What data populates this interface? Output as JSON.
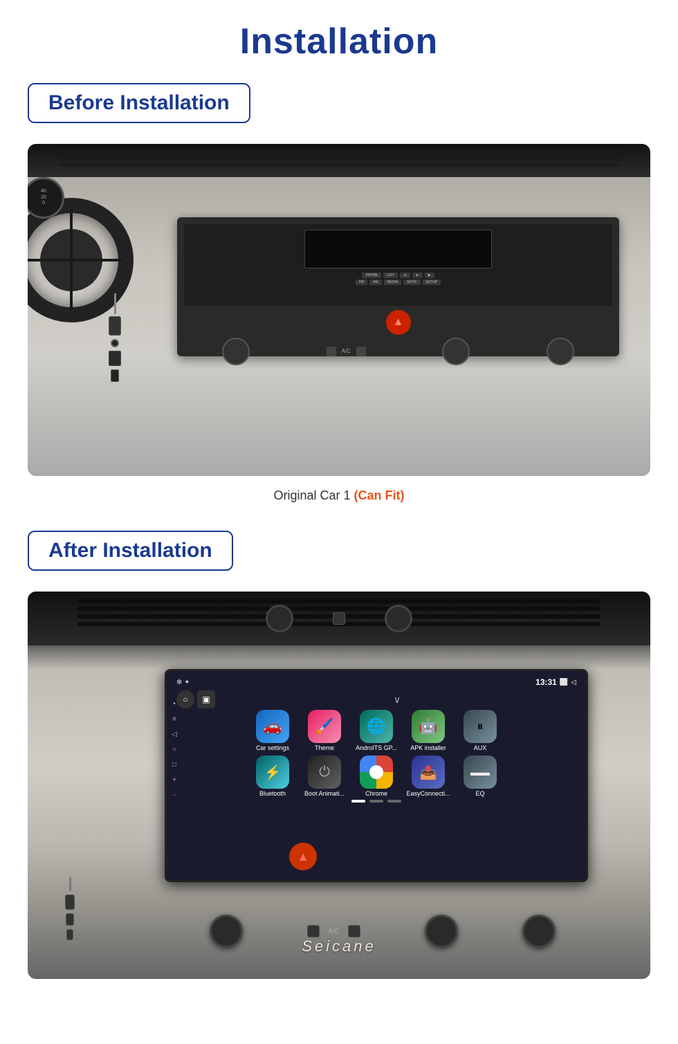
{
  "page": {
    "title": "Installation",
    "before_label": "Before Installation",
    "after_label": "After Installation",
    "caption_text": "Original Car  1",
    "caption_fit": "(Can Fit)",
    "seicane_brand": "Seicane",
    "accent_color": "#1a3a8f",
    "fit_color": "#e8541a"
  },
  "android_screen": {
    "status_time": "13:31",
    "apps_row1": [
      {
        "label": "Car settings",
        "icon": "🚗",
        "color_class": "app-blue"
      },
      {
        "label": "Theme",
        "icon": "🎨",
        "color_class": "app-pink"
      },
      {
        "label": "AndroITS GP...",
        "icon": "🌐",
        "color_class": "app-teal"
      },
      {
        "label": "APK installer",
        "icon": "🤖",
        "color_class": "app-green"
      },
      {
        "label": "AUX",
        "icon": "🎚",
        "color_class": "app-gray"
      }
    ],
    "apps_row2": [
      {
        "label": "Bluetooth",
        "icon": "🔵",
        "color_class": "app-cyan"
      },
      {
        "label": "Boot Animati...",
        "icon": "⏻",
        "color_class": "app-dark"
      },
      {
        "label": "Chrome",
        "icon": "🌐",
        "color_class": "app-orange-g"
      },
      {
        "label": "EasyConnecti...",
        "icon": "📤",
        "color_class": "app-blue2"
      },
      {
        "label": "EQ",
        "icon": "📋",
        "color_class": "app-gray"
      }
    ]
  }
}
